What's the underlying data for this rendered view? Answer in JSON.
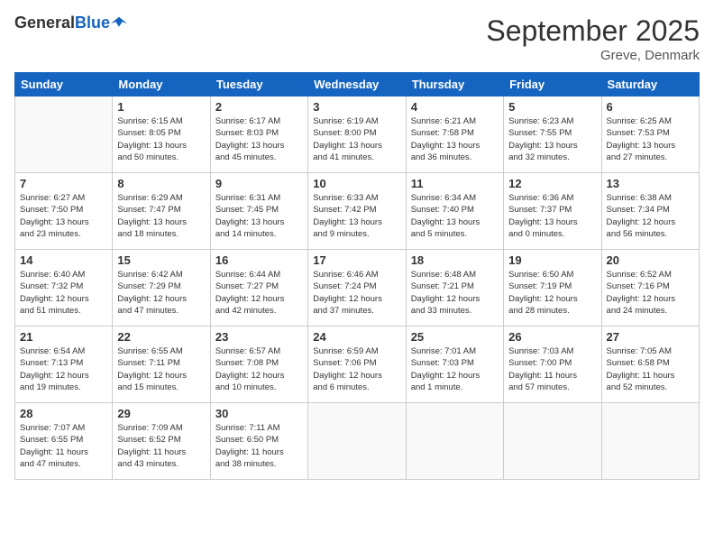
{
  "logo": {
    "line1": "General",
    "line2": "Blue"
  },
  "title": "September 2025",
  "subtitle": "Greve, Denmark",
  "weekdays": [
    "Sunday",
    "Monday",
    "Tuesday",
    "Wednesday",
    "Thursday",
    "Friday",
    "Saturday"
  ],
  "weeks": [
    [
      {
        "day": "",
        "info": ""
      },
      {
        "day": "1",
        "info": "Sunrise: 6:15 AM\nSunset: 8:05 PM\nDaylight: 13 hours\nand 50 minutes."
      },
      {
        "day": "2",
        "info": "Sunrise: 6:17 AM\nSunset: 8:03 PM\nDaylight: 13 hours\nand 45 minutes."
      },
      {
        "day": "3",
        "info": "Sunrise: 6:19 AM\nSunset: 8:00 PM\nDaylight: 13 hours\nand 41 minutes."
      },
      {
        "day": "4",
        "info": "Sunrise: 6:21 AM\nSunset: 7:58 PM\nDaylight: 13 hours\nand 36 minutes."
      },
      {
        "day": "5",
        "info": "Sunrise: 6:23 AM\nSunset: 7:55 PM\nDaylight: 13 hours\nand 32 minutes."
      },
      {
        "day": "6",
        "info": "Sunrise: 6:25 AM\nSunset: 7:53 PM\nDaylight: 13 hours\nand 27 minutes."
      }
    ],
    [
      {
        "day": "7",
        "info": "Sunrise: 6:27 AM\nSunset: 7:50 PM\nDaylight: 13 hours\nand 23 minutes."
      },
      {
        "day": "8",
        "info": "Sunrise: 6:29 AM\nSunset: 7:47 PM\nDaylight: 13 hours\nand 18 minutes."
      },
      {
        "day": "9",
        "info": "Sunrise: 6:31 AM\nSunset: 7:45 PM\nDaylight: 13 hours\nand 14 minutes."
      },
      {
        "day": "10",
        "info": "Sunrise: 6:33 AM\nSunset: 7:42 PM\nDaylight: 13 hours\nand 9 minutes."
      },
      {
        "day": "11",
        "info": "Sunrise: 6:34 AM\nSunset: 7:40 PM\nDaylight: 13 hours\nand 5 minutes."
      },
      {
        "day": "12",
        "info": "Sunrise: 6:36 AM\nSunset: 7:37 PM\nDaylight: 13 hours\nand 0 minutes."
      },
      {
        "day": "13",
        "info": "Sunrise: 6:38 AM\nSunset: 7:34 PM\nDaylight: 12 hours\nand 56 minutes."
      }
    ],
    [
      {
        "day": "14",
        "info": "Sunrise: 6:40 AM\nSunset: 7:32 PM\nDaylight: 12 hours\nand 51 minutes."
      },
      {
        "day": "15",
        "info": "Sunrise: 6:42 AM\nSunset: 7:29 PM\nDaylight: 12 hours\nand 47 minutes."
      },
      {
        "day": "16",
        "info": "Sunrise: 6:44 AM\nSunset: 7:27 PM\nDaylight: 12 hours\nand 42 minutes."
      },
      {
        "day": "17",
        "info": "Sunrise: 6:46 AM\nSunset: 7:24 PM\nDaylight: 12 hours\nand 37 minutes."
      },
      {
        "day": "18",
        "info": "Sunrise: 6:48 AM\nSunset: 7:21 PM\nDaylight: 12 hours\nand 33 minutes."
      },
      {
        "day": "19",
        "info": "Sunrise: 6:50 AM\nSunset: 7:19 PM\nDaylight: 12 hours\nand 28 minutes."
      },
      {
        "day": "20",
        "info": "Sunrise: 6:52 AM\nSunset: 7:16 PM\nDaylight: 12 hours\nand 24 minutes."
      }
    ],
    [
      {
        "day": "21",
        "info": "Sunrise: 6:54 AM\nSunset: 7:13 PM\nDaylight: 12 hours\nand 19 minutes."
      },
      {
        "day": "22",
        "info": "Sunrise: 6:55 AM\nSunset: 7:11 PM\nDaylight: 12 hours\nand 15 minutes."
      },
      {
        "day": "23",
        "info": "Sunrise: 6:57 AM\nSunset: 7:08 PM\nDaylight: 12 hours\nand 10 minutes."
      },
      {
        "day": "24",
        "info": "Sunrise: 6:59 AM\nSunset: 7:06 PM\nDaylight: 12 hours\nand 6 minutes."
      },
      {
        "day": "25",
        "info": "Sunrise: 7:01 AM\nSunset: 7:03 PM\nDaylight: 12 hours\nand 1 minute."
      },
      {
        "day": "26",
        "info": "Sunrise: 7:03 AM\nSunset: 7:00 PM\nDaylight: 11 hours\nand 57 minutes."
      },
      {
        "day": "27",
        "info": "Sunrise: 7:05 AM\nSunset: 6:58 PM\nDaylight: 11 hours\nand 52 minutes."
      }
    ],
    [
      {
        "day": "28",
        "info": "Sunrise: 7:07 AM\nSunset: 6:55 PM\nDaylight: 11 hours\nand 47 minutes."
      },
      {
        "day": "29",
        "info": "Sunrise: 7:09 AM\nSunset: 6:52 PM\nDaylight: 11 hours\nand 43 minutes."
      },
      {
        "day": "30",
        "info": "Sunrise: 7:11 AM\nSunset: 6:50 PM\nDaylight: 11 hours\nand 38 minutes."
      },
      {
        "day": "",
        "info": ""
      },
      {
        "day": "",
        "info": ""
      },
      {
        "day": "",
        "info": ""
      },
      {
        "day": "",
        "info": ""
      }
    ]
  ]
}
